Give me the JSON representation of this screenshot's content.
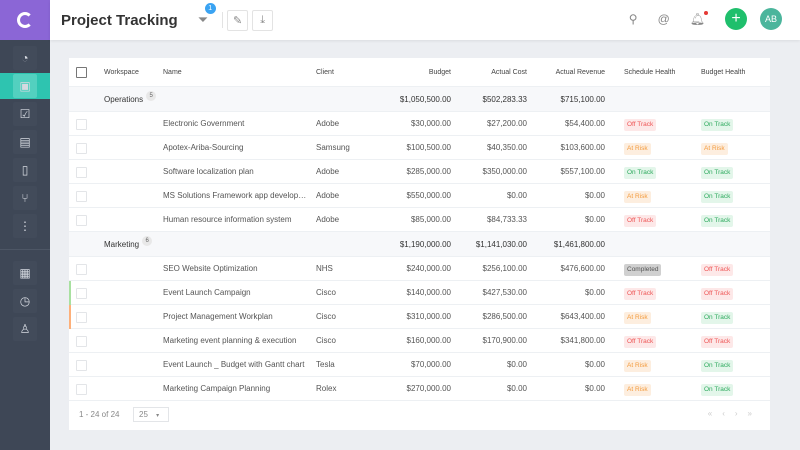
{
  "app": {
    "title": "Project Tracking",
    "filter_count": "1",
    "user_initials": "AB"
  },
  "colors": {
    "sidebar": "#3e4756",
    "logo": "#8b66d6",
    "active": "#2ec4b0",
    "add": "#1fbf6c",
    "avatar": "#4bb59c"
  },
  "sidebar": {
    "items": [
      {
        "icon": "dashboard-icon",
        "glyph": "◔"
      },
      {
        "icon": "briefcase-icon",
        "glyph": "▣",
        "active": true
      },
      {
        "icon": "clipboard-check-icon",
        "glyph": "☑"
      },
      {
        "icon": "presentation-icon",
        "glyph": "▤"
      },
      {
        "icon": "document-icon",
        "glyph": "▯"
      },
      {
        "icon": "branch-icon",
        "glyph": "⑂"
      },
      {
        "icon": "more-icon",
        "glyph": "⋮"
      }
    ],
    "bottom": [
      {
        "icon": "chart-icon",
        "glyph": "▦"
      },
      {
        "icon": "clock-icon",
        "glyph": "◷"
      },
      {
        "icon": "user-check-icon",
        "glyph": "♙"
      }
    ]
  },
  "table": {
    "columns": [
      "Workspace",
      "Name",
      "Client",
      "Budget",
      "Actual Cost",
      "Actual Revenue",
      "Schedule Health",
      "Budget Health"
    ],
    "groups": [
      {
        "name": "Operations",
        "count": "5",
        "budget": "$1,050,500.00",
        "cost": "$502,283.33",
        "revenue": "$715,100.00",
        "rows": [
          {
            "name": "Electronic Government",
            "client": "Adobe",
            "budget": "$30,000.00",
            "cost": "$27,200.00",
            "revenue": "$54,400.00",
            "schedule": "Off Track",
            "budget_health": "On Track"
          },
          {
            "name": "Apotex-Ariba-Sourcing",
            "client": "Samsung",
            "budget": "$100,500.00",
            "cost": "$40,350.00",
            "revenue": "$103,600.00",
            "schedule": "At Risk",
            "budget_health": "At Risk"
          },
          {
            "name": "Software localization plan",
            "client": "Adobe",
            "budget": "$285,000.00",
            "cost": "$350,000.00",
            "revenue": "$557,100.00",
            "schedule": "On Track",
            "budget_health": "On Track"
          },
          {
            "name": "MS Solutions Framework app development",
            "client": "Adobe",
            "budget": "$550,000.00",
            "cost": "$0.00",
            "revenue": "$0.00",
            "schedule": "At Risk",
            "budget_health": "On Track"
          },
          {
            "name": "Human resource information system",
            "client": "Adobe",
            "budget": "$85,000.00",
            "cost": "$84,733.33",
            "revenue": "$0.00",
            "schedule": "Off Track",
            "budget_health": "On Track"
          }
        ]
      },
      {
        "name": "Marketing",
        "count": "6",
        "budget": "$1,190,000.00",
        "cost": "$1,141,030.00",
        "revenue": "$1,461,800.00",
        "rows": [
          {
            "name": "SEO Website Optimization",
            "client": "NHS",
            "budget": "$240,000.00",
            "cost": "$256,100.00",
            "revenue": "$476,600.00",
            "schedule": "Completed",
            "budget_health": "Off Track"
          },
          {
            "name": "Event Launch Campaign",
            "client": "Cisco",
            "budget": "$140,000.00",
            "cost": "$427,530.00",
            "revenue": "$0.00",
            "schedule": "Off Track",
            "budget_health": "Off Track",
            "strip": "#a8e0a0"
          },
          {
            "name": "Project Management Workplan",
            "client": "Cisco",
            "budget": "$310,000.00",
            "cost": "$286,500.00",
            "revenue": "$643,400.00",
            "schedule": "At Risk",
            "budget_health": "On Track",
            "strip": "#fdb07a"
          },
          {
            "name": "Marketing event planning & execution",
            "client": "Cisco",
            "budget": "$160,000.00",
            "cost": "$170,900.00",
            "revenue": "$341,800.00",
            "schedule": "Off Track",
            "budget_health": "Off Track"
          },
          {
            "name": "Event Launch _ Budget with Gantt chart",
            "client": "Tesla",
            "budget": "$70,000.00",
            "cost": "$0.00",
            "revenue": "$0.00",
            "schedule": "At Risk",
            "budget_health": "On Track"
          },
          {
            "name": "Marketing Campaign Planning",
            "client": "Rolex",
            "budget": "$270,000.00",
            "cost": "$0.00",
            "revenue": "$0.00",
            "schedule": "At Risk",
            "budget_health": "On Track"
          }
        ]
      }
    ]
  },
  "pager": {
    "count": "1 - 24 of 24",
    "page_size": "25",
    "nav": "«‹›»"
  }
}
